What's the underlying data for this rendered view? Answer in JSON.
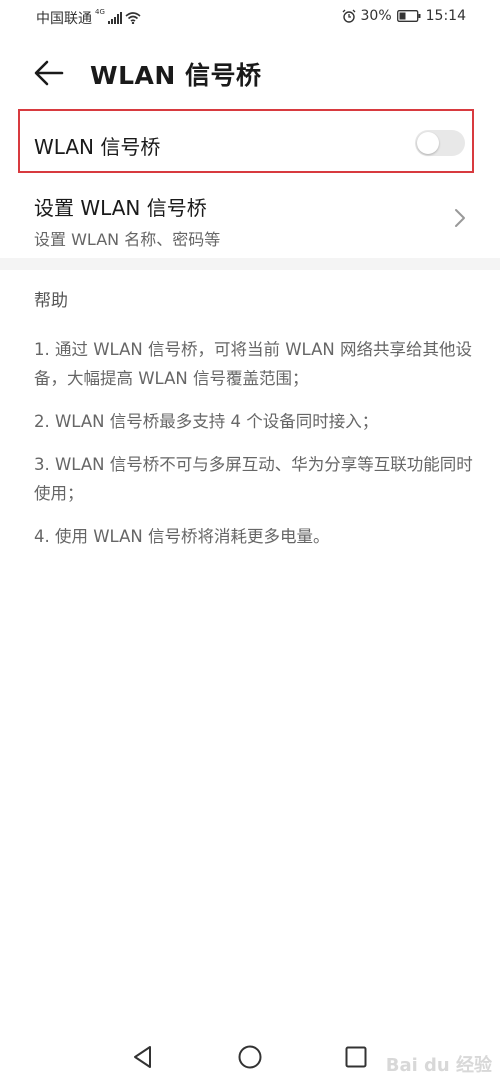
{
  "status_bar": {
    "carrier": "中国联通",
    "network_type": "4G",
    "battery_percent": "30%",
    "time": "15:14"
  },
  "header": {
    "title": "WLAN 信号桥"
  },
  "toggle": {
    "label": "WLAN 信号桥",
    "state": "off"
  },
  "settings": {
    "title": "设置 WLAN 信号桥",
    "subtitle": "设置 WLAN 名称、密码等"
  },
  "help": {
    "heading": "帮助",
    "items": [
      "1. 通过 WLAN 信号桥，可将当前 WLAN 网络共享给其他设备，大幅提高 WLAN 信号覆盖范围；",
      "2. WLAN 信号桥最多支持 4 个设备同时接入；",
      "3. WLAN 信号桥不可与多屏互动、华为分享等互联功能同时使用；",
      "4. 使用 WLAN 信号桥将消耗更多电量。"
    ]
  },
  "watermark": "Bai du 经验",
  "colors": {
    "highlight_border": "#d83a3f",
    "switch_off_track": "#e8e8e8"
  }
}
